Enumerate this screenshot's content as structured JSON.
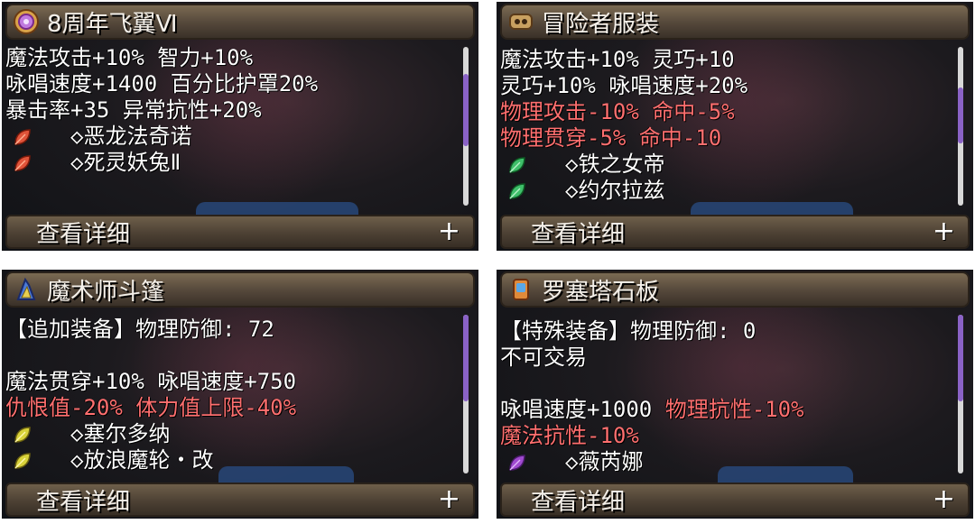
{
  "panels": [
    {
      "title": "8周年飞翼Ⅵ",
      "icon": "gold-medal-icon",
      "lines": [
        {
          "segments": [
            {
              "text": "魔法攻击+10% 智力+10%",
              "color": "white"
            }
          ]
        },
        {
          "segments": [
            {
              "text": "咏唱速度+1400 百分比护罩20%",
              "color": "white"
            }
          ]
        },
        {
          "segments": [
            {
              "text": "暴击率+35 异常抗性+20%",
              "color": "white"
            }
          ]
        }
      ],
      "sets": [
        {
          "label": "◇恶龙法奇诺",
          "leaf_color": "#e0543a"
        },
        {
          "label": "◇死灵妖兔Ⅱ",
          "leaf_color": "#e0543a"
        }
      ],
      "detail_label": "查看详细",
      "plus_label": "+",
      "scroll_fraction": 0.45
    },
    {
      "title": "冒险者服装",
      "icon": "adventurer-outfit-icon",
      "lines": [
        {
          "segments": [
            {
              "text": "魔法攻击+10% 灵巧+10",
              "color": "white"
            }
          ]
        },
        {
          "segments": [
            {
              "text": "灵巧+10% 咏唱速度+20%",
              "color": "white"
            }
          ]
        },
        {
          "segments": [
            {
              "text": "物理攻击-10% 命中-5%",
              "color": "red"
            }
          ]
        },
        {
          "segments": [
            {
              "text": "物理贯穿-5% 命中-10",
              "color": "red"
            }
          ]
        }
      ],
      "sets": [
        {
          "label": "◇铁之女帝",
          "leaf_color": "#3fbf6a"
        },
        {
          "label": "◇约尔拉兹",
          "leaf_color": "#3fbf6a"
        }
      ],
      "detail_label": "查看详细",
      "plus_label": "+",
      "scroll_fraction": 0.35
    },
    {
      "title": "魔术师斗篷",
      "icon": "magician-cloak-icon",
      "lines": [
        {
          "segments": [
            {
              "text": "【追加装备】物理防御: 72",
              "color": "white"
            }
          ]
        },
        {
          "segments": [],
          "blank": true
        },
        {
          "segments": [
            {
              "text": "魔法贯穿+10% 咏唱速度+750",
              "color": "white"
            }
          ]
        },
        {
          "segments": [
            {
              "text": "仇恨值-20% 体力值上限-40%",
              "color": "red"
            }
          ]
        }
      ],
      "sets": [
        {
          "label": "◇塞尔多纳",
          "leaf_color": "#d8d23a"
        },
        {
          "label": "◇放浪魔轮・改",
          "leaf_color": "#d8d23a"
        }
      ],
      "detail_label": "查看详细",
      "plus_label": "+",
      "scroll_fraction": 0.55
    },
    {
      "title": "罗塞塔石板",
      "icon": "rosetta-stone-icon",
      "lines": [
        {
          "segments": [
            {
              "text": "【特殊装备】物理防御: 0",
              "color": "white"
            }
          ]
        },
        {
          "segments": [
            {
              "text": "不可交易",
              "color": "white"
            }
          ]
        },
        {
          "segments": [],
          "blank": true
        },
        {
          "segments": [
            {
              "text": "咏唱速度+1000 ",
              "color": "white"
            },
            {
              "text": "物理抗性-10%",
              "color": "red"
            }
          ]
        },
        {
          "segments": [
            {
              "text": "魔法抗性-10%",
              "color": "red"
            }
          ]
        }
      ],
      "sets": [
        {
          "label": "◇薇芮娜",
          "leaf_color": "#a04ad0"
        }
      ],
      "detail_label": "查看详细",
      "plus_label": "+",
      "scroll_fraction": 0.55
    }
  ]
}
